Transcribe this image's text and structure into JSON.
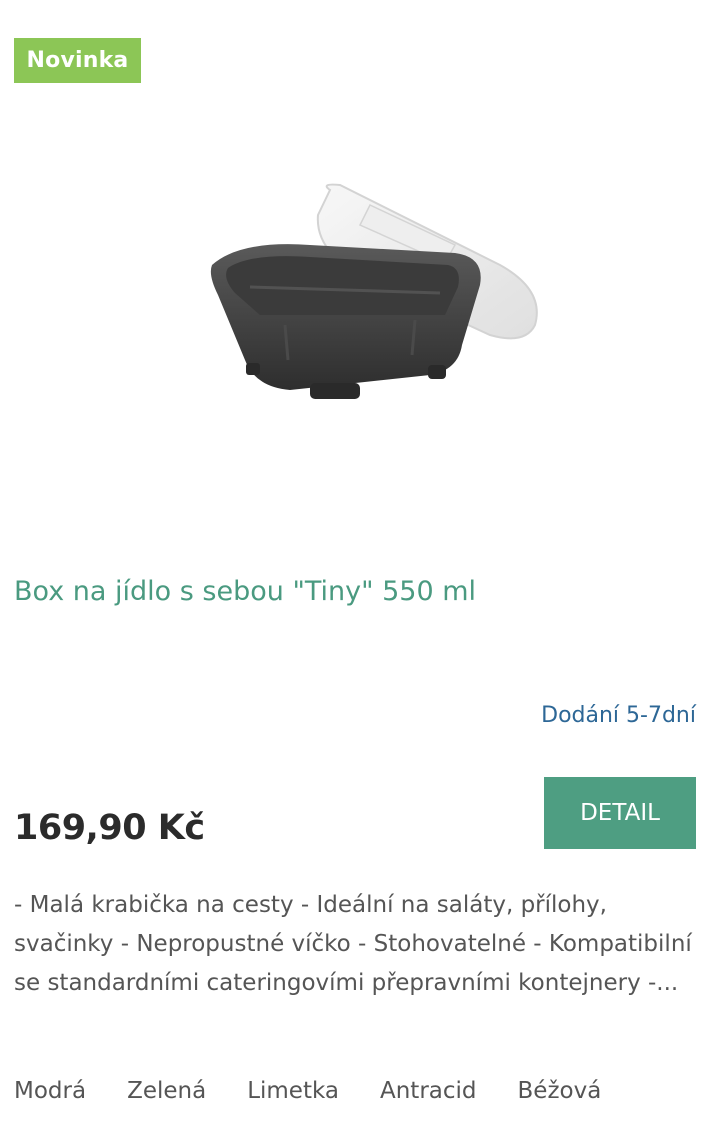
{
  "badge": {
    "label": "Novinka",
    "color": "#8cc656"
  },
  "product": {
    "image_icon": "food-box-with-lid-image",
    "title": "Box na jídlo s sebou \"Tiny\" 550 ml",
    "delivery": "Dodání 5-7dní",
    "price": "169,90 Kč",
    "detail_label": "DETAIL",
    "description": "- Malá krabička na cesty - Ideální na saláty, přílohy, svačinky - Nepropustné víčko - Stohovatelné - Kompatibilní se standardními cateringovími přepravními kontejnery -..."
  },
  "colors": {
    "options": [
      "Modrá",
      "Zelená",
      "Limetka",
      "Antracid",
      "Béžová"
    ]
  },
  "theme": {
    "accent": "#4e9e82",
    "title_color": "#4a9a80",
    "delivery_color": "#2d6796"
  }
}
